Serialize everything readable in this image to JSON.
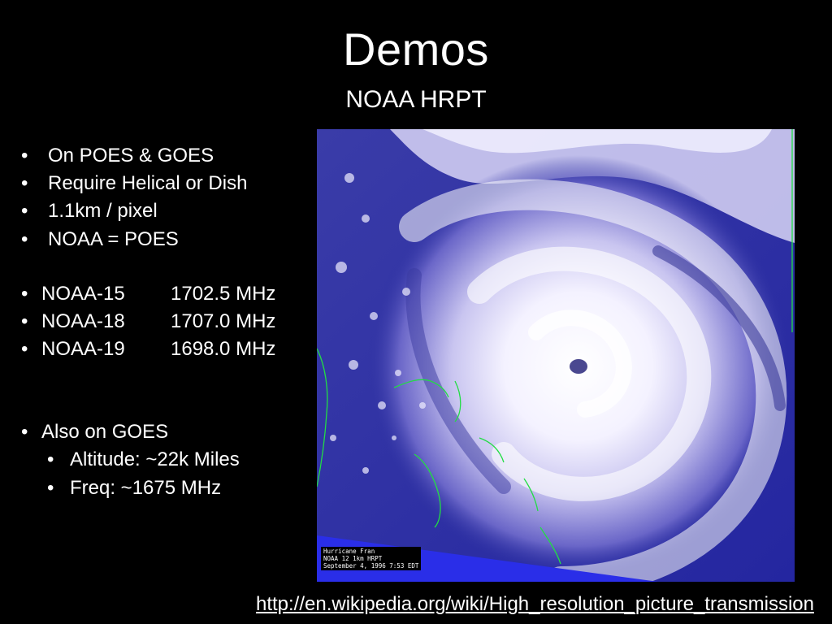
{
  "slide": {
    "title": "Demos",
    "subtitle": "NOAA HRPT"
  },
  "bullets_group1": [
    {
      "dot": "•",
      "text": "On POES & GOES"
    },
    {
      "dot": "•",
      "text": "Require Helical or Dish"
    },
    {
      "dot": "•",
      "text": "1.1km / pixel"
    },
    {
      "dot": "•",
      "text": "NOAA = POES"
    }
  ],
  "satellites": [
    {
      "dot": "•",
      "name": "NOAA-15",
      "freq": "1702.5 MHz"
    },
    {
      "dot": "•",
      "name": "NOAA-18",
      "freq": "1707.0 MHz"
    },
    {
      "dot": "•",
      "name": "NOAA-19",
      "freq": "1698.0 MHz"
    }
  ],
  "goes": {
    "dot": "•",
    "text": "Also on GOES",
    "sub": [
      {
        "dot": "•",
        "text": "Altitude: ~22k Miles"
      },
      {
        "dot": "•",
        "text": "Freq: ~1675 MHz"
      }
    ]
  },
  "image": {
    "caption_lines": [
      "Hurricane Fran",
      "NOAA 12 1km HRPT",
      "September 4, 1996 7:53 EDT"
    ],
    "colors": {
      "ocean": "#2b2fa0",
      "cloud": "#f2f0ff",
      "cloud_shadow": "#8a86d6",
      "coastline": "#22dd44"
    }
  },
  "source": {
    "link_text": "http://en.wikipedia.org/wiki/High_resolution_picture_transmission"
  }
}
